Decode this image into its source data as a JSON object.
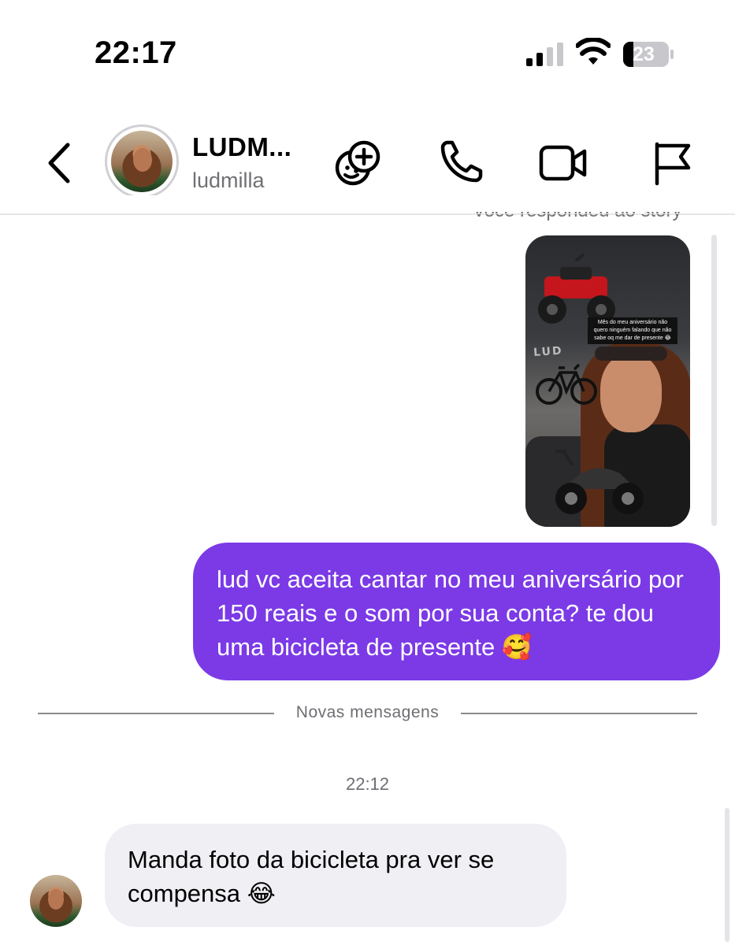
{
  "status_bar": {
    "time": "22:17",
    "battery": "23"
  },
  "header": {
    "display_name": "LUDM...",
    "username": "ludmilla"
  },
  "story_reply": {
    "caption": "Você respondeu ao story",
    "story_text": "Mês do meu aniversário não quero ninguém falando que não sabe oq me dar de presente 😂",
    "neon_text": "LUD"
  },
  "messages": {
    "outgoing_text": "lud vc aceita cantar no meu aniversário por 150 reais e o som por sua conta? te dou uma bicicleta de presente 🥰",
    "divider_label": "Novas mensagens",
    "timestamp": "22:12",
    "incoming_text": "Manda foto da bicicleta pra ver se compensa 😂"
  },
  "colors": {
    "outgoing_bubble": "#7b3ae6",
    "incoming_bubble": "#efeff4"
  }
}
